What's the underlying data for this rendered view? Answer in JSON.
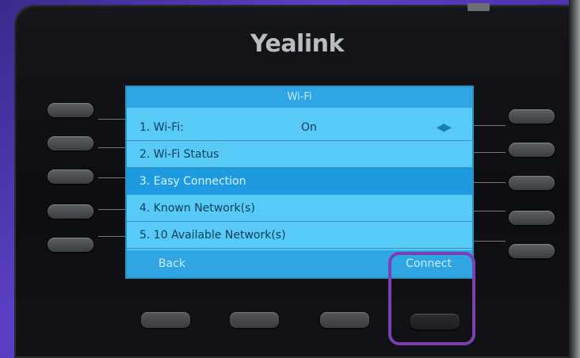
{
  "device": {
    "brand": "Yealink"
  },
  "screen": {
    "title": "Wi-Fi",
    "menu_items": [
      {
        "label": "1. Wi-Fi:",
        "value": "On",
        "arrows": "◀▶"
      },
      {
        "label": "2. Wi-Fi Status"
      },
      {
        "label": "3. Easy Connection"
      },
      {
        "label": "4. Known Network(s)"
      },
      {
        "label": "5. 10 Available Network(s)"
      }
    ],
    "selected_index": 2,
    "softkeys": {
      "left": "Back",
      "right": "Connect"
    }
  },
  "colors": {
    "screen_bg": "#58caf7",
    "title_bar": "#2fa6e3",
    "selected_row": "#1e9ae0",
    "highlight": "#7a3fb1"
  }
}
